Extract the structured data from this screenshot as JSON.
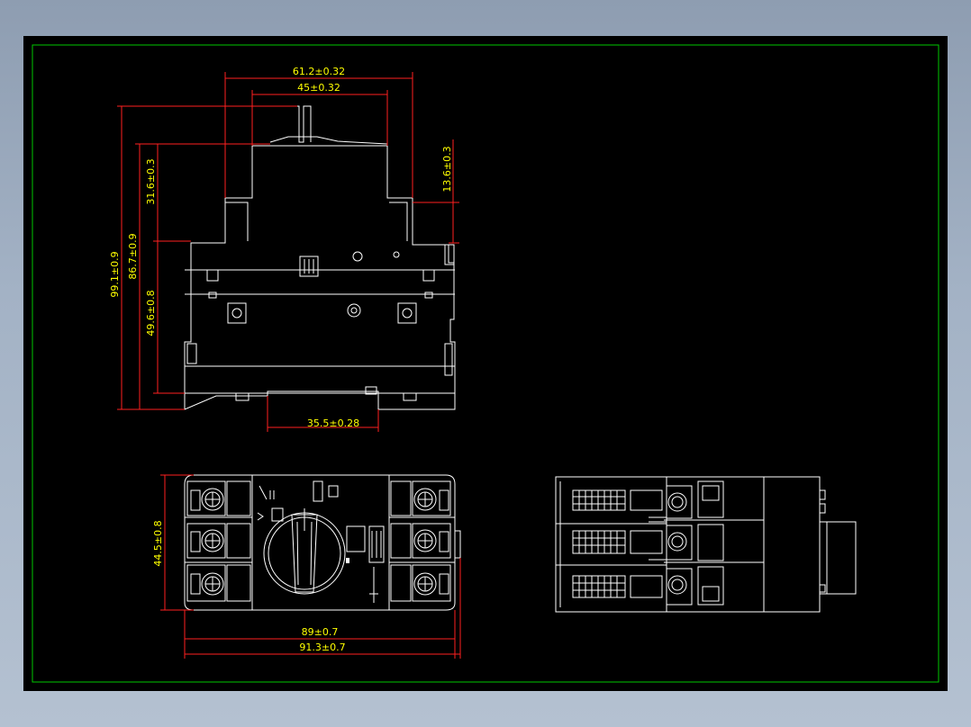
{
  "colors": {
    "background": "#000000",
    "frame": "#00c800",
    "outline": "#ffffff",
    "dimension_line": "#ff2020",
    "dimension_text": "#ffff00"
  },
  "dimensions": {
    "top_width_outer": "61.2±0.32",
    "top_width_inner": "45±0.32",
    "right_step": "13.6±0.3",
    "height_total": "99.1±0.9",
    "height_body": "86.7±0.9",
    "height_upper": "31.6±0.3",
    "height_lower": "49.6±0.8",
    "rail_width": "35.5±0.28",
    "front_height": "44.5±0.8",
    "front_width_inner": "89±0.7",
    "front_width_outer": "91.3±0.7"
  }
}
